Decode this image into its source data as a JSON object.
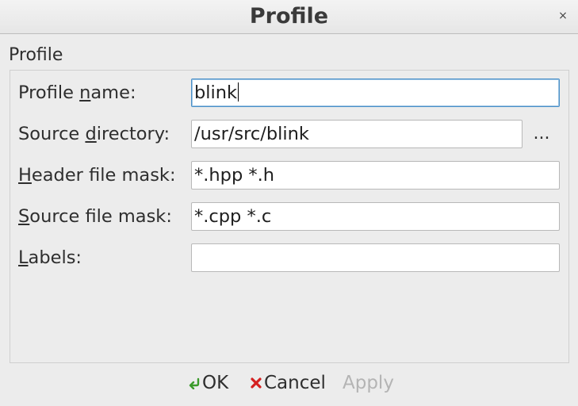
{
  "window": {
    "title": "Profile",
    "close_glyph": "×"
  },
  "group": {
    "label": "Profile"
  },
  "fields": {
    "profile_name": {
      "label_pre": "Profile ",
      "label_accel": "n",
      "label_post": "ame:",
      "value": "blink"
    },
    "source_directory": {
      "label_pre": "Source ",
      "label_accel": "d",
      "label_post": "irectory:",
      "value": "/usr/src/blink"
    },
    "header_mask": {
      "label_pre": "",
      "label_accel": "H",
      "label_post": "eader file mask:",
      "value": "*.hpp *.h"
    },
    "source_mask": {
      "label_pre": "",
      "label_accel": "S",
      "label_post": "ource file mask:",
      "value": "*.cpp *.c"
    },
    "labels": {
      "label_pre": "",
      "label_accel": "L",
      "label_post": "abels:",
      "value": ""
    }
  },
  "browse": {
    "label": "..."
  },
  "buttons": {
    "ok": {
      "label": "OK",
      "icon": "green-check-arrow-icon"
    },
    "cancel": {
      "label": "Cancel",
      "icon": "red-x-icon"
    },
    "apply": {
      "label": "Apply",
      "disabled": true
    }
  },
  "colors": {
    "ok_icon": "#3a9a2a",
    "cancel_icon": "#d42020",
    "focus_border": "#4a90c8"
  }
}
